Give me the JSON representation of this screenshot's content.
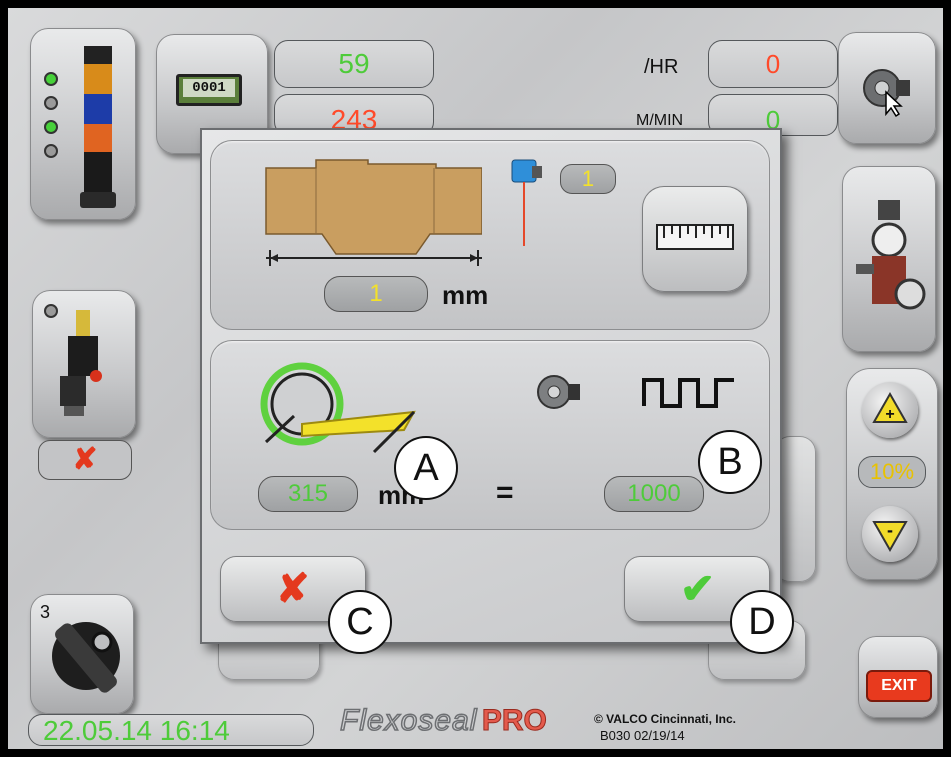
{
  "header": {
    "batch_icon_text": "0001",
    "count_value": "59",
    "count_value_2": "243",
    "rate_label": "/HR",
    "rate_value": "0",
    "speed_label": "M/MIN",
    "speed_value": "0"
  },
  "right_panel": {
    "percent": "10%",
    "plus": "+",
    "minus": "-",
    "exit_label": "EXIT"
  },
  "left_panel": {
    "tool_badge": "3"
  },
  "footer": {
    "datetime": "22.05.14 16:14",
    "brand_main": "Flexoseal",
    "brand_pro": "PRO",
    "copyright": "© VALCO Cincinnati, Inc.",
    "version": "B030 02/19/14"
  },
  "dialog": {
    "sensor_count": "1",
    "length_value": "1",
    "length_unit": "mm",
    "circumference_value": "315",
    "circumference_unit": "mm",
    "equals": "=",
    "pulses_value": "1000",
    "cancel_symbol": "✘",
    "confirm_symbol": "✔"
  },
  "callouts": {
    "a": "A",
    "b": "B",
    "c": "C",
    "d": "D"
  },
  "colors": {
    "green_value": "#4ecb3a",
    "red_value": "#ff4a2a",
    "exit_red": "#e83a1e",
    "panel_grey": "#c8c9cb"
  }
}
